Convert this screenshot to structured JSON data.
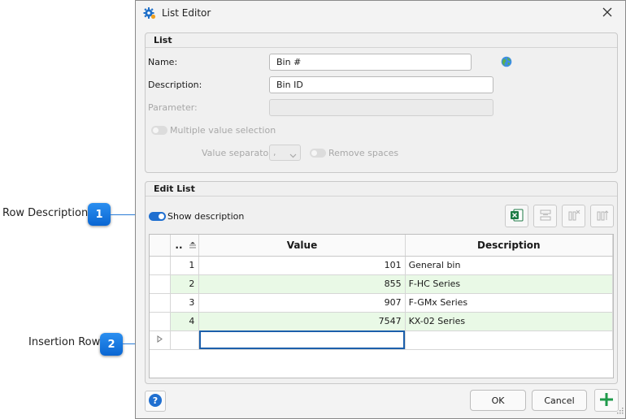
{
  "callouts": [
    {
      "label": "Row Description",
      "number": "1"
    },
    {
      "label": "Insertion Row",
      "number": "2"
    }
  ],
  "window": {
    "title": "List Editor",
    "icon": "gear-icon",
    "close_icon": "close-icon"
  },
  "list_group": {
    "title": "List",
    "name_label": "Name:",
    "name_value": "Bin #",
    "description_label": "Description:",
    "description_value": "Bin ID",
    "parameter_label": "Parameter:",
    "parameter_value": "",
    "multiple_value_label": "Multiple value selection",
    "multiple_value_on": false,
    "value_separator_label": "Value separator",
    "value_separator_value": ",",
    "remove_spaces_label": "Remove spaces",
    "remove_spaces_on": false,
    "globe_icon": "globe-icon"
  },
  "edit_group": {
    "title": "Edit List",
    "show_description_label": "Show description",
    "show_description_on": true,
    "toolbar_icons": [
      "excel-icon",
      "delete-row-icon",
      "delete-column-icon",
      "move-column-icon"
    ]
  },
  "grid": {
    "columns": {
      "index": "..",
      "value": "Value",
      "description": "Description"
    },
    "rows": [
      {
        "num": "1",
        "value": "101",
        "description": "General bin"
      },
      {
        "num": "2",
        "value": "855",
        "description": "F-HC Series"
      },
      {
        "num": "3",
        "value": "907",
        "description": "F-GMx Series"
      },
      {
        "num": "4",
        "value": "7547",
        "description": "KX-02 Series"
      }
    ]
  },
  "footer": {
    "ok": "OK",
    "cancel": "Cancel",
    "help_icon": "help-icon",
    "add_icon": "plus-icon"
  },
  "colors": {
    "accent": "#1f6fd0",
    "alt_row": "#e9f9e6",
    "add_green": "#1f9a4a"
  }
}
